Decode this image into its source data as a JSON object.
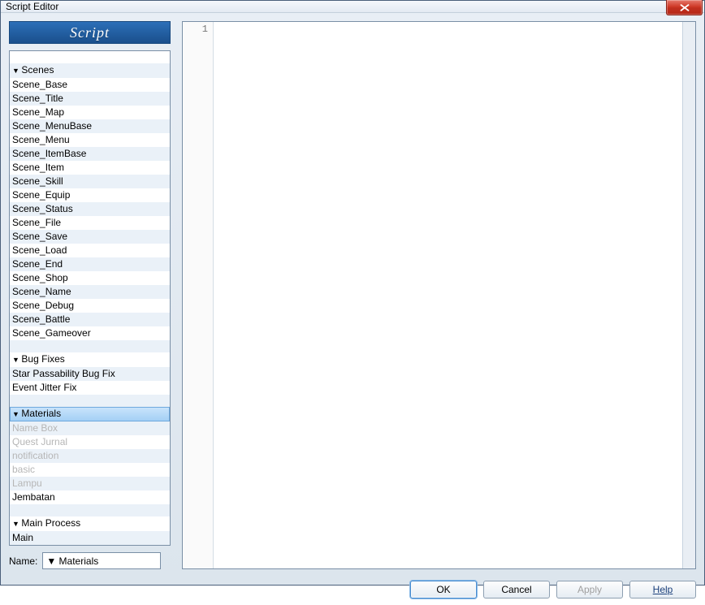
{
  "window_title": "Script Editor",
  "panel_header": "Script",
  "script_groups": [
    {
      "category": "Scenes",
      "items": [
        "Scene_Base",
        "Scene_Title",
        "Scene_Map",
        "Scene_MenuBase",
        "Scene_Menu",
        "Scene_ItemBase",
        "Scene_Item",
        "Scene_Skill",
        "Scene_Equip",
        "Scene_Status",
        "Scene_File",
        "Scene_Save",
        "Scene_Load",
        "Scene_End",
        "Scene_Shop",
        "Scene_Name",
        "Scene_Debug",
        "Scene_Battle",
        "Scene_Gameover"
      ]
    },
    {
      "category": "Bug Fixes",
      "items": [
        "Star Passability Bug Fix",
        "Event Jitter Fix"
      ]
    },
    {
      "category": "Materials",
      "selected": true,
      "items_faded": [
        "Name Box",
        "Quest Jurnal",
        "notification",
        "basic",
        "Lampu"
      ],
      "items": [
        "Jembatan"
      ]
    },
    {
      "category": "Main Process",
      "items": [
        "Main"
      ]
    }
  ],
  "editor": {
    "line_numbers": [
      "1"
    ],
    "content": ""
  },
  "name_field": {
    "label": "Name:",
    "value": "▼ Materials"
  },
  "buttons": {
    "ok": "OK",
    "cancel": "Cancel",
    "apply": "Apply",
    "help": "Help"
  }
}
